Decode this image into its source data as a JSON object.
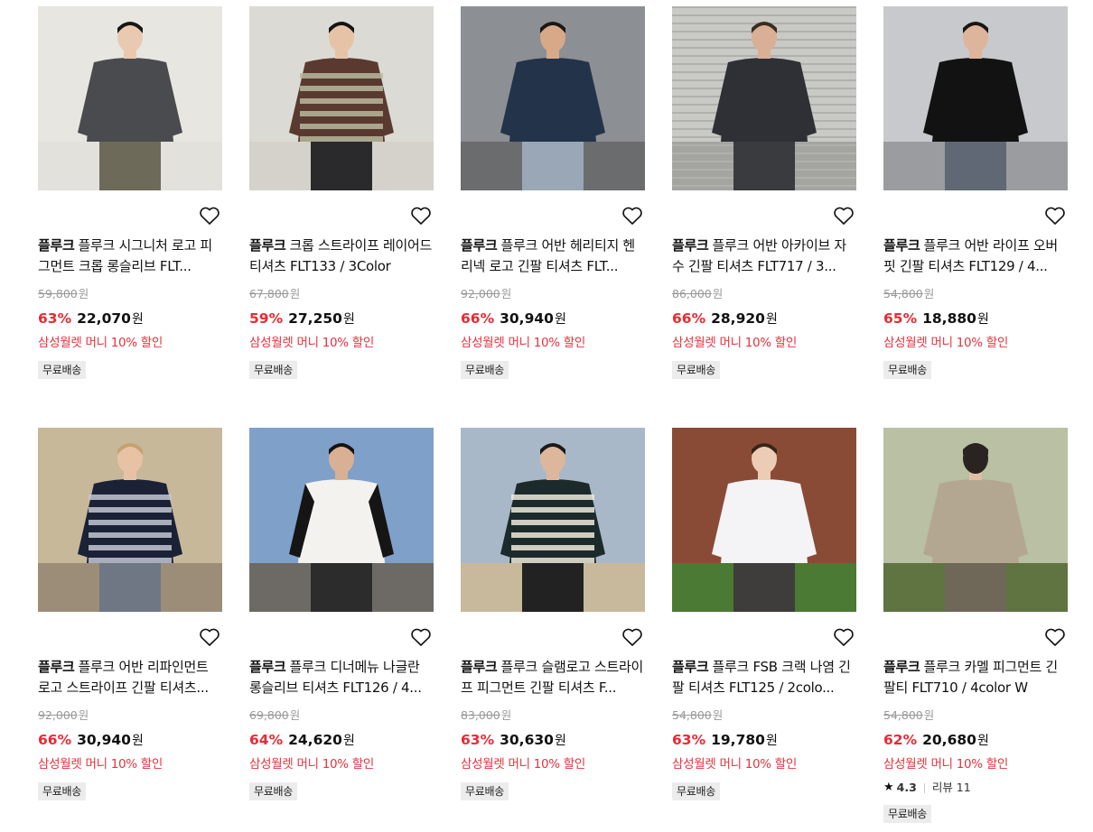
{
  "currency": "원",
  "products": [
    {
      "brand": "플루크",
      "name": "플루크 시그니처 로고 피그먼트 크롭 롱슬리브 FLT...",
      "original_price": "59,800",
      "discount_rate": "63%",
      "sale_price": "22,070",
      "benefit": "삼성월렛 머니 10% 할인",
      "shipping": "무료배송",
      "rating": null,
      "reviews": null
    },
    {
      "brand": "플루크",
      "name": "크롭 스트라이프 레이어드 티셔츠 FLT133 / 3Color",
      "original_price": "67,800",
      "discount_rate": "59%",
      "sale_price": "27,250",
      "benefit": "삼성월렛 머니 10% 할인",
      "shipping": "무료배송",
      "rating": null,
      "reviews": null
    },
    {
      "brand": "플루크",
      "name": "플루크 어반 헤리티지 헨리넥 로고 긴팔 티셔츠 FLT...",
      "original_price": "92,000",
      "discount_rate": "66%",
      "sale_price": "30,940",
      "benefit": "삼성월렛 머니 10% 할인",
      "shipping": "무료배송",
      "rating": null,
      "reviews": null
    },
    {
      "brand": "플루크",
      "name": "플루크 어반 아카이브 자수 긴팔 티셔츠 FLT717 / 3...",
      "original_price": "86,000",
      "discount_rate": "66%",
      "sale_price": "28,920",
      "benefit": "삼성월렛 머니 10% 할인",
      "shipping": "무료배송",
      "rating": null,
      "reviews": null
    },
    {
      "brand": "플루크",
      "name": "플루크 어반 라이프 오버핏 긴팔 티셔츠 FLT129 / 4...",
      "original_price": "54,800",
      "discount_rate": "65%",
      "sale_price": "18,880",
      "benefit": "삼성월렛 머니 10% 할인",
      "shipping": "무료배송",
      "rating": null,
      "reviews": null
    },
    {
      "brand": "플루크",
      "name": "플루크 어반 리파인먼트 로고 스트라이프 긴팔 티셔츠...",
      "original_price": "92,000",
      "discount_rate": "66%",
      "sale_price": "30,940",
      "benefit": "삼성월렛 머니 10% 할인",
      "shipping": "무료배송",
      "rating": null,
      "reviews": null
    },
    {
      "brand": "플루크",
      "name": "플루크 디너메뉴 나글란 롱슬리브 티셔츠 FLT126 / 4...",
      "original_price": "69,800",
      "discount_rate": "64%",
      "sale_price": "24,620",
      "benefit": "삼성월렛 머니 10% 할인",
      "shipping": "무료배송",
      "rating": null,
      "reviews": null
    },
    {
      "brand": "플루크",
      "name": "플루크 슬램로고 스트라이프 피그먼트 긴팔 티셔츠 F...",
      "original_price": "83,000",
      "discount_rate": "63%",
      "sale_price": "30,630",
      "benefit": "삼성월렛 머니 10% 할인",
      "shipping": "무료배송",
      "rating": null,
      "reviews": null
    },
    {
      "brand": "플루크",
      "name": "플루크 FSB 크랙 나염 긴팔 티셔츠 FLT125 / 2colo...",
      "original_price": "54,800",
      "discount_rate": "63%",
      "sale_price": "19,780",
      "benefit": "삼성월렛 머니 10% 할인",
      "shipping": "무료배송",
      "rating": null,
      "reviews": null
    },
    {
      "brand": "플루크",
      "name": "플루크 카멜 피그먼트 긴팔티 FLT710 / 4color W",
      "original_price": "54,800",
      "discount_rate": "62%",
      "sale_price": "20,680",
      "benefit": "삼성월렛 머니 10% 할인",
      "shipping": "무료배송",
      "rating": "4.3",
      "reviews": "리뷰 11"
    }
  ],
  "icons": {
    "wishlist": "heart-outline-icon",
    "rating": "star-icon"
  },
  "colors": {
    "discount": "#ea2a35",
    "benefit": "#e7323f",
    "badge_bg": "#ececec"
  }
}
